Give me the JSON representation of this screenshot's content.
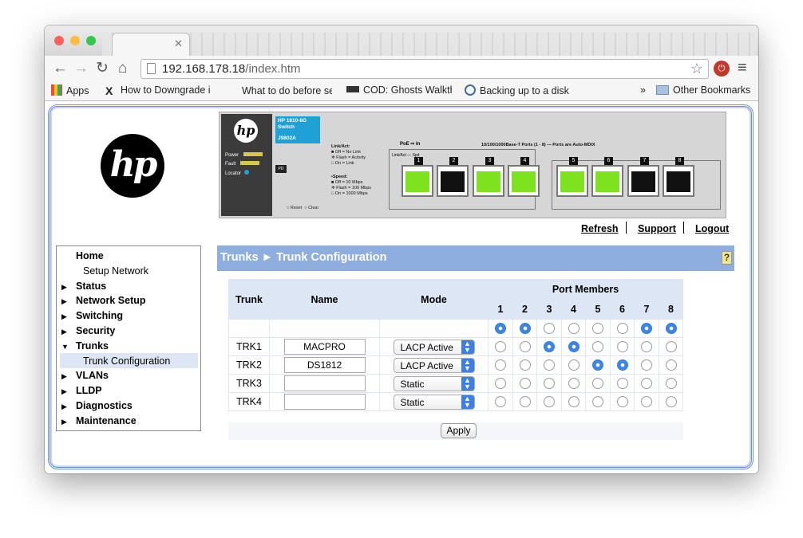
{
  "browser": {
    "url_host": "192.168.178.18",
    "url_path": "/index.htm",
    "bookmarks": [
      "Apps",
      "How to Downgrade i",
      "What to do before se",
      "COD: Ghosts Walkth",
      "Backing up to a disk",
      "Other Bookmarks"
    ],
    "overflow": "»"
  },
  "switch_graphic": {
    "model_line1": "HP 1810-8G",
    "model_line2": "Switch",
    "model_sku": "J9802A",
    "leds": [
      "Power",
      "Fault",
      "Locator"
    ],
    "pd": "PD",
    "legend_link_title": "Link/Act:",
    "legend_link": [
      "Off = No Link",
      "Flash = Activity",
      "On = Link"
    ],
    "legend_speed_title": "Speed:",
    "legend_speed": [
      "Off = 10 Mbps",
      "Flash = 100 Mbps",
      "On = 1000 Mbps"
    ],
    "reset": "Reset",
    "clear": "Clear",
    "poe_label": "PoE",
    "in_label": "In",
    "link_act_spd": "Link/Act — Spd",
    "ports_title": "10/100/1000Base-T Ports (1 - 8) — Ports are Auto-MDIX",
    "ports": [
      {
        "num": "1",
        "color": "#7ee21e"
      },
      {
        "num": "2",
        "color": "#111111"
      },
      {
        "num": "3",
        "color": "#7ee21e"
      },
      {
        "num": "4",
        "color": "#7ee21e"
      },
      {
        "num": "5",
        "color": "#7ee21e"
      },
      {
        "num": "6",
        "color": "#7ee21e"
      },
      {
        "num": "7",
        "color": "#111111"
      },
      {
        "num": "8",
        "color": "#111111"
      }
    ]
  },
  "header_links": [
    "Refresh",
    "Support",
    "Logout"
  ],
  "nav": {
    "items": [
      {
        "label": "Home",
        "arrow": ""
      },
      {
        "label": "Setup Network",
        "sub": true
      },
      {
        "label": "Status",
        "arrow": "▶"
      },
      {
        "label": "Network Setup",
        "arrow": "▶"
      },
      {
        "label": "Switching",
        "arrow": "▶"
      },
      {
        "label": "Security",
        "arrow": "▶"
      },
      {
        "label": "Trunks",
        "arrow": "▼"
      },
      {
        "label": "Trunk Configuration",
        "sub": true,
        "active": true
      },
      {
        "label": "VLANs",
        "arrow": "▶"
      },
      {
        "label": "LLDP",
        "arrow": "▶"
      },
      {
        "label": "Diagnostics",
        "arrow": "▶"
      },
      {
        "label": "Maintenance",
        "arrow": "▶"
      }
    ]
  },
  "section_title": "Trunks ► Trunk Configuration",
  "help_icon": "?",
  "table": {
    "col_trunk": "Trunk",
    "col_name": "Name",
    "col_mode": "Mode",
    "col_ports": "Port Members",
    "port_numbers": [
      "1",
      "2",
      "3",
      "4",
      "5",
      "6",
      "7",
      "8"
    ],
    "header_row_selected": [
      true,
      true,
      false,
      false,
      false,
      false,
      true,
      true
    ],
    "rows": [
      {
        "trunk": "TRK1",
        "name": "MACPRO",
        "mode": "LACP Active",
        "ports": [
          false,
          false,
          true,
          true,
          false,
          false,
          false,
          false
        ]
      },
      {
        "trunk": "TRK2",
        "name": "DS1812",
        "mode": "LACP Active",
        "ports": [
          false,
          false,
          false,
          false,
          true,
          true,
          false,
          false
        ]
      },
      {
        "trunk": "TRK3",
        "name": "",
        "mode": "Static",
        "ports": [
          false,
          false,
          false,
          false,
          false,
          false,
          false,
          false
        ]
      },
      {
        "trunk": "TRK4",
        "name": "",
        "mode": "Static",
        "ports": [
          false,
          false,
          false,
          false,
          false,
          false,
          false,
          false
        ]
      }
    ]
  },
  "apply_label": "Apply"
}
